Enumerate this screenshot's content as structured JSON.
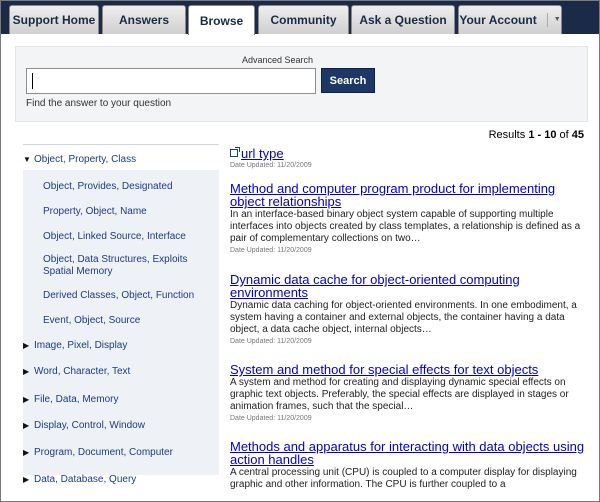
{
  "tabs": [
    {
      "label": "Support Home",
      "active": false
    },
    {
      "label": "Answers",
      "active": false
    },
    {
      "label": "Browse",
      "active": true
    },
    {
      "label": "Community",
      "active": false
    },
    {
      "label": "Ask a Question",
      "active": false
    },
    {
      "label": "Your Account",
      "active": false,
      "dropdown": true
    }
  ],
  "search": {
    "advanced_label": "Advanced Search",
    "value": "",
    "button_label": "Search",
    "hint": "Find the answer to your question"
  },
  "results_count": {
    "prefix": "Results ",
    "range": "1 - 10",
    "of": " of ",
    "total": "45"
  },
  "sidebar": {
    "expanded": {
      "label": "Object, Property, Class",
      "children": [
        "Object, Provides, Designated",
        "Property, Object, Name",
        "Object, Linked Source, Interface",
        "Object, Data Structures, Exploits Spatial Memory",
        "Derived Classes, Object, Function",
        "Event, Object, Source"
      ]
    },
    "collapsed": [
      "Image, Pixel, Display",
      "Word, Character, Text",
      "File, Data, Memory",
      "Display, Control, Window",
      "Program, Document, Computer",
      "Data, Database, Query"
    ]
  },
  "results": [
    {
      "title": "url type",
      "date": "Date Updated: 11/20/2009",
      "snippet": ""
    },
    {
      "title": "Method and computer program product for implementing object relationships",
      "date": "Date Updated: 11/20/2009",
      "snippet": "In an interface-based binary object system capable of supporting multiple interfaces into objects created by class templates, a relationship is defined as a pair of complementary collections on two…"
    },
    {
      "title": "Dynamic data cache for object-oriented computing environments",
      "date": "Date Updated: 11/20/2009",
      "snippet": "Dynamic data caching for object-oriented environments. In one embodiment, a system having a container and external objects, the container having a data object, a data cache object, internal objects…"
    },
    {
      "title": "System and method for special effects for text objects",
      "date": "Date Updated: 11/20/2009",
      "snippet": "A system and method for creating and displaying dynamic special effects on graphic text objects. Preferably, the special effects are displayed in stages or animation frames, such that the special…"
    },
    {
      "title": "Methods and apparatus for interacting with data objects using action handles",
      "date": "",
      "snippet": "A central processing unit (CPU) is coupled to a computer display for displaying graphic and other information. The CPU is further coupled to a"
    }
  ],
  "icons": {
    "expanded": "triangle-down-icon",
    "collapsed": "triangle-right-icon",
    "url": "external-link-icon",
    "dropdown": "caret-down-icon"
  },
  "colors": {
    "tabbar": "#1a2a47",
    "link": "#0000cc",
    "category": "#1b3c8a",
    "button": "#1d3866",
    "subpanel": "#eef1f5"
  }
}
